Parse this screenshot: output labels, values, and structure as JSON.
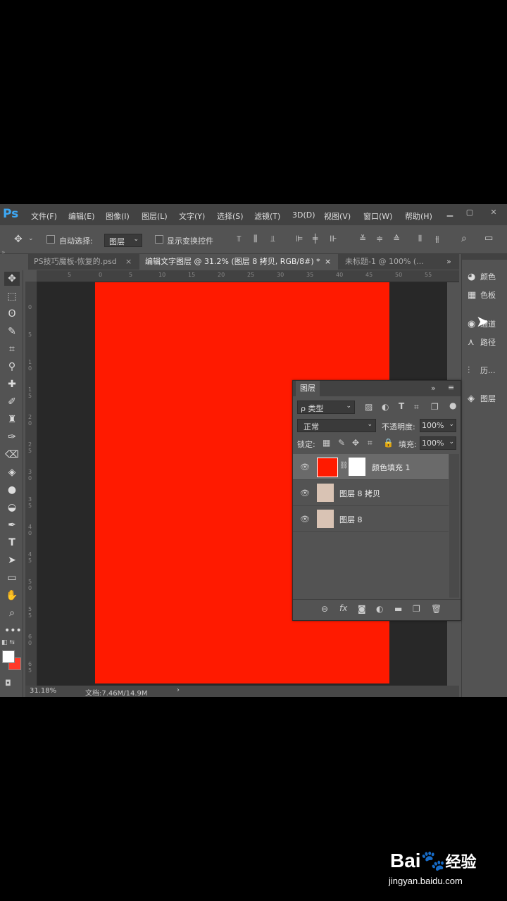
{
  "app": {
    "logo": "Ps",
    "menu": [
      "文件(F)",
      "编辑(E)",
      "图像(I)",
      "图层(L)",
      "文字(Y)",
      "选择(S)",
      "滤镜(T)",
      "3D(D)",
      "视图(V)",
      "窗口(W)",
      "帮助(H)"
    ]
  },
  "options": {
    "auto_select_label": "自动选择:",
    "auto_select_value": "图层",
    "show_transform_label": "显示变换控件"
  },
  "tabs": [
    {
      "label": "PS技巧魔板-恢复的.psd",
      "close": "×"
    },
    {
      "label": "编辑文字图层 @ 31.2% (图层 8 拷贝, RGB/8#) *",
      "close": "×"
    },
    {
      "label": "未标题-1 @ 100% (..."
    }
  ],
  "tab_overflow": "»",
  "ruler": {
    "h": [
      "5",
      "0",
      "5",
      "10",
      "15",
      "20",
      "25",
      "30",
      "35",
      "40",
      "45",
      "50",
      "55"
    ],
    "v": [
      "0",
      "5",
      "1 0",
      "1 5",
      "2 0",
      "2 5",
      "3 0",
      "3 5",
      "4 0",
      "4 5",
      "5 0",
      "5 5",
      "6 0",
      "6 5"
    ]
  },
  "status": {
    "zoom": "31.18%",
    "doc": "文档:7.46M/14.9M",
    "arrow": "›"
  },
  "dock": {
    "items": [
      "颜色",
      "色板",
      "通道",
      "路径",
      "历...",
      "图层"
    ]
  },
  "layers_panel": {
    "title": "图层",
    "filter_label": "ρ 类型",
    "blend_mode": "正常",
    "opacity_label": "不透明度:",
    "opacity_value": "100%",
    "lock_label": "锁定:",
    "fill_label": "填充:",
    "fill_value": "100%",
    "layers": [
      {
        "name": "颜色填充 1",
        "type": "fill",
        "fill_color": "#ff1a00"
      },
      {
        "name": "图层 8 拷贝",
        "type": "photo"
      },
      {
        "name": "图层 8",
        "type": "photo"
      }
    ]
  },
  "colors": {
    "canvas_red": "#ff1a00",
    "ps_blue": "#3da8f5"
  },
  "watermark": {
    "brand": "Bai",
    "brand2": "经验",
    "url": "jingyan.baidu.com"
  }
}
